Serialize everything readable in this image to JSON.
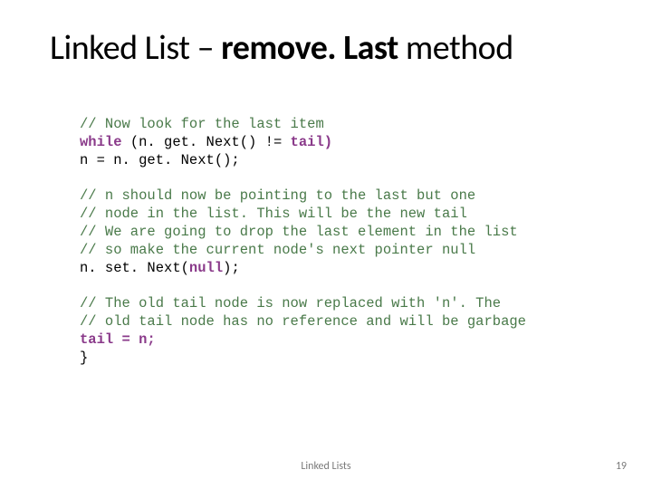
{
  "title": {
    "pre": "Linked List – ",
    "bold": "remove. Last",
    "post": " method"
  },
  "code": {
    "l01": "// Now look for the last item",
    "l02a": "while",
    "l02b": " (n. get. Next() != ",
    "l02c": "tail)",
    "l03": "n = n. get. Next();",
    "l04": "",
    "l05": "// n should now be pointing to the last but one",
    "l06": "// node in the list. This will be the new tail",
    "l07": "// We are going to drop the last element in the list",
    "l08": "// so make the current node's next pointer null",
    "l09a": "n. set. Next(",
    "l09b": "null",
    "l09c": ");",
    "l10": "",
    "l11": "// The old tail node is now replaced with 'n'. The",
    "l12": "// old tail node has no reference and will be garbage",
    "l13a": "tail = n;",
    "l14": "}"
  },
  "footer": {
    "center": "Linked Lists",
    "page": "19"
  }
}
